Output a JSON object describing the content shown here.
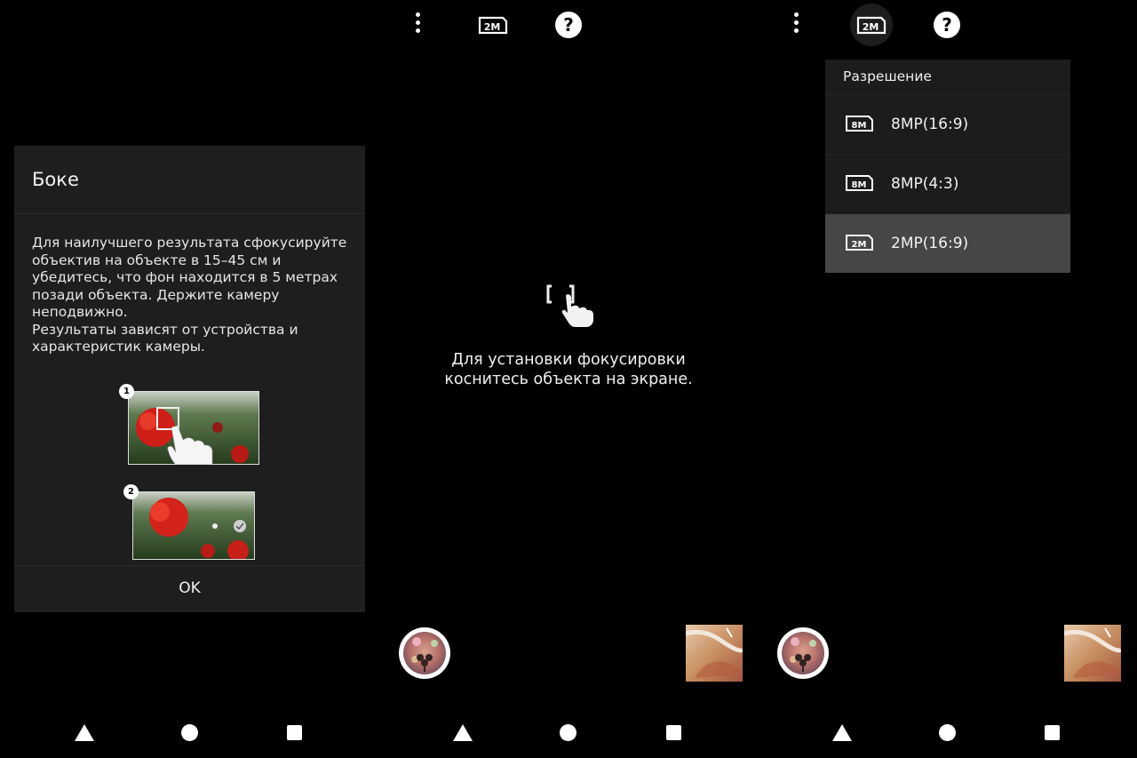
{
  "dialog": {
    "title": "Боке",
    "body": "Для наилучшего результата сфокусируйте\nобъектив на объекте в 15–45 см  и\nубедитесь, что фон находится в 5 метрах\nпозади объекта. Держите камеру\nнеподвижно.\nРезультаты зависят от устройства и\nхарактеристик камеры.",
    "step1": "1",
    "step2": "2",
    "ok_label": "OK"
  },
  "topbar": {
    "resolution_badge": "2M",
    "icons": [
      "more-vert-icon",
      "resolution-icon",
      "help-icon"
    ]
  },
  "viewfinder": {
    "hint": "Для установки фокусировки\nкоснитесь объекта на экране."
  },
  "resolution_menu": {
    "title": "Разрешение",
    "items": [
      {
        "badge": "8M",
        "label": "8MP(16:9)",
        "selected": false
      },
      {
        "badge": "8M",
        "label": "8MP(4:3)",
        "selected": false
      },
      {
        "badge": "2M",
        "label": "2MP(16:9)",
        "selected": true
      }
    ]
  },
  "navbar": {
    "icons": [
      "back-icon",
      "home-icon",
      "recents-icon"
    ]
  },
  "colors": {
    "background": "#000000",
    "dialog_bg": "#1e1e1e",
    "menu_bg": "#1c1c1c",
    "menu_selected": "#464646",
    "text": "#ffffff"
  }
}
